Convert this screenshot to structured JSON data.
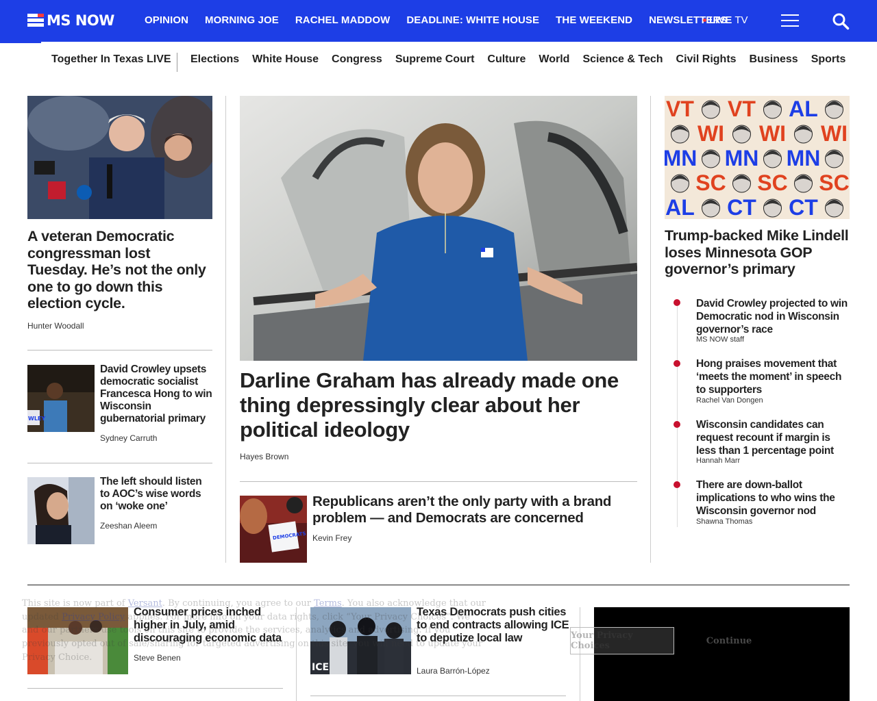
{
  "brand": {
    "name": "MS NOW"
  },
  "nav": {
    "items": [
      "OPINION",
      "MORNING JOE",
      "RACHEL MADDOW",
      "DEADLINE: WHITE HOUSE",
      "THE WEEKEND",
      "NEWSLETTERS"
    ],
    "live_label": "LIVE",
    "live_suffix": "TV"
  },
  "subnav": {
    "featured": "Together In Texas LIVE",
    "items": [
      "Elections",
      "White House",
      "Congress",
      "Supreme Court",
      "Culture",
      "World",
      "Science & Tech",
      "Civil Rights",
      "Business",
      "Sports"
    ]
  },
  "left": {
    "lead": {
      "headline": "A veteran Democratic congressman lost Tuesday. He’s not the only one to go down this election cycle.",
      "author": "Hunter Woodall"
    },
    "stories": [
      {
        "headline": "David Crowley upsets democratic socialist Francesca Hong to win Wisconsin gubernatorial primary",
        "author": "Sydney Carruth"
      },
      {
        "headline": "The left should listen to AOC’s wise words on ‘woke one’",
        "author": "Zeeshan Aleem"
      }
    ]
  },
  "center": {
    "lead": {
      "headline": "Darline Graham has already made one thing depressingly clear about her political ideology",
      "author": "Hayes Brown"
    },
    "story": {
      "headline": "Republicans aren’t the only party with a brand problem — and Democrats are concerned",
      "author": "Kevin Frey",
      "sign_text": "DEMOCRATS"
    }
  },
  "right": {
    "lead": {
      "headline": "Trump-backed Mike Lindell loses Minnesota GOP governor’s primary"
    },
    "collage_labels": [
      "VT",
      "VT",
      "AL",
      "WI",
      "WI",
      "WI",
      "MN",
      "MN",
      "MN",
      "SC",
      "SC",
      "SC",
      "AL",
      "CT",
      "CT"
    ],
    "list": [
      {
        "headline": "David Crowley projected to win Democratic nod in Wisconsin governor’s race",
        "author": "MS NOW staff"
      },
      {
        "headline": "Hong praises movement that ‘meets the moment’ in speech to supporters",
        "author": "Rachel Van Dongen"
      },
      {
        "headline": "Wisconsin candidates can request recount if margin is less than 1 percentage point",
        "author": "Hannah Marr"
      },
      {
        "headline": "There are down-ballot implications to who wins the Wisconsin governor nod",
        "author": "Shawna Thomas"
      }
    ]
  },
  "bottom": {
    "stories": [
      {
        "headline": "Consumer prices inched higher in July, amid discouraging economic data",
        "author": "Steve Benen"
      },
      {
        "headline": "Texas Democrats push cities to end contracts allowing ICE to deputize local law",
        "author": "Laura Barrón-López"
      }
    ]
  },
  "privacy": {
    "line1_a": "This site is now part of ",
    "line1_link": "Versant",
    "line1_b": ". By continuing, you agree to our ",
    "terms": "Terms",
    "line1_c": ". You also acknowledge that our updated",
    "line2_link": "Privacy Policy",
    "line2_b": " applies. For more info on your data rights, click “Your Privacy Choices”.",
    "line3": "We and our partners use tools on this site to provide the services, analytics and advertising. If you previously opted out of sale/sharing for targeted advertising on this site, you will need to update your Privacy Choice.",
    "choices_button": "Your Privacy Choices",
    "continue_button": "Continue"
  },
  "colors": {
    "brand_blue": "#1d3ee6",
    "accent_red": "#c8102e"
  }
}
